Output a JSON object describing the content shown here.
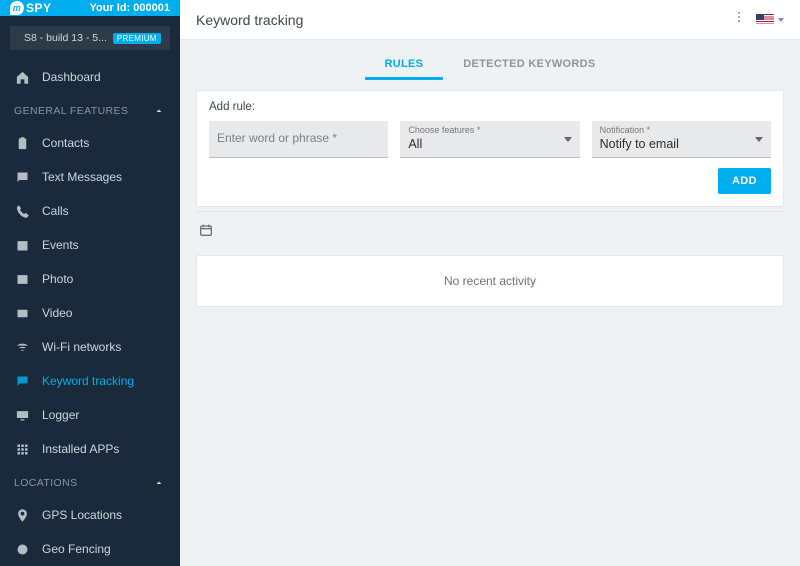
{
  "brand": {
    "name": "SPY",
    "user_id_label": "Your Id:",
    "user_id": "000001"
  },
  "device": {
    "name": "S8 - build 13 - 5...",
    "badge": "PREMIUM"
  },
  "nav": {
    "dashboard": "Dashboard",
    "sections": {
      "general": {
        "title": "GENERAL FEATURES",
        "items": {
          "contacts": "Contacts",
          "text_messages": "Text Messages",
          "calls": "Calls",
          "events": "Events",
          "photo": "Photo",
          "video": "Video",
          "wifi": "Wi-Fi networks",
          "keyword": "Keyword tracking",
          "logger": "Logger",
          "apps": "Installed APPs"
        }
      },
      "locations": {
        "title": "LOCATIONS",
        "items": {
          "gps": "GPS Locations",
          "geo": "Geo Fencing"
        }
      }
    }
  },
  "header": {
    "title": "Keyword tracking"
  },
  "tabs": {
    "rules": "RULES",
    "detected": "DETECTED KEYWORDS"
  },
  "rules": {
    "panel_title": "Add rule:",
    "phrase_placeholder": "Enter word or phrase *",
    "features_label": "Choose features *",
    "features_value": "All",
    "notification_label": "Notification *",
    "notification_value": "Notify to email",
    "add_btn": "ADD"
  },
  "activity": {
    "empty": "No recent activity"
  }
}
